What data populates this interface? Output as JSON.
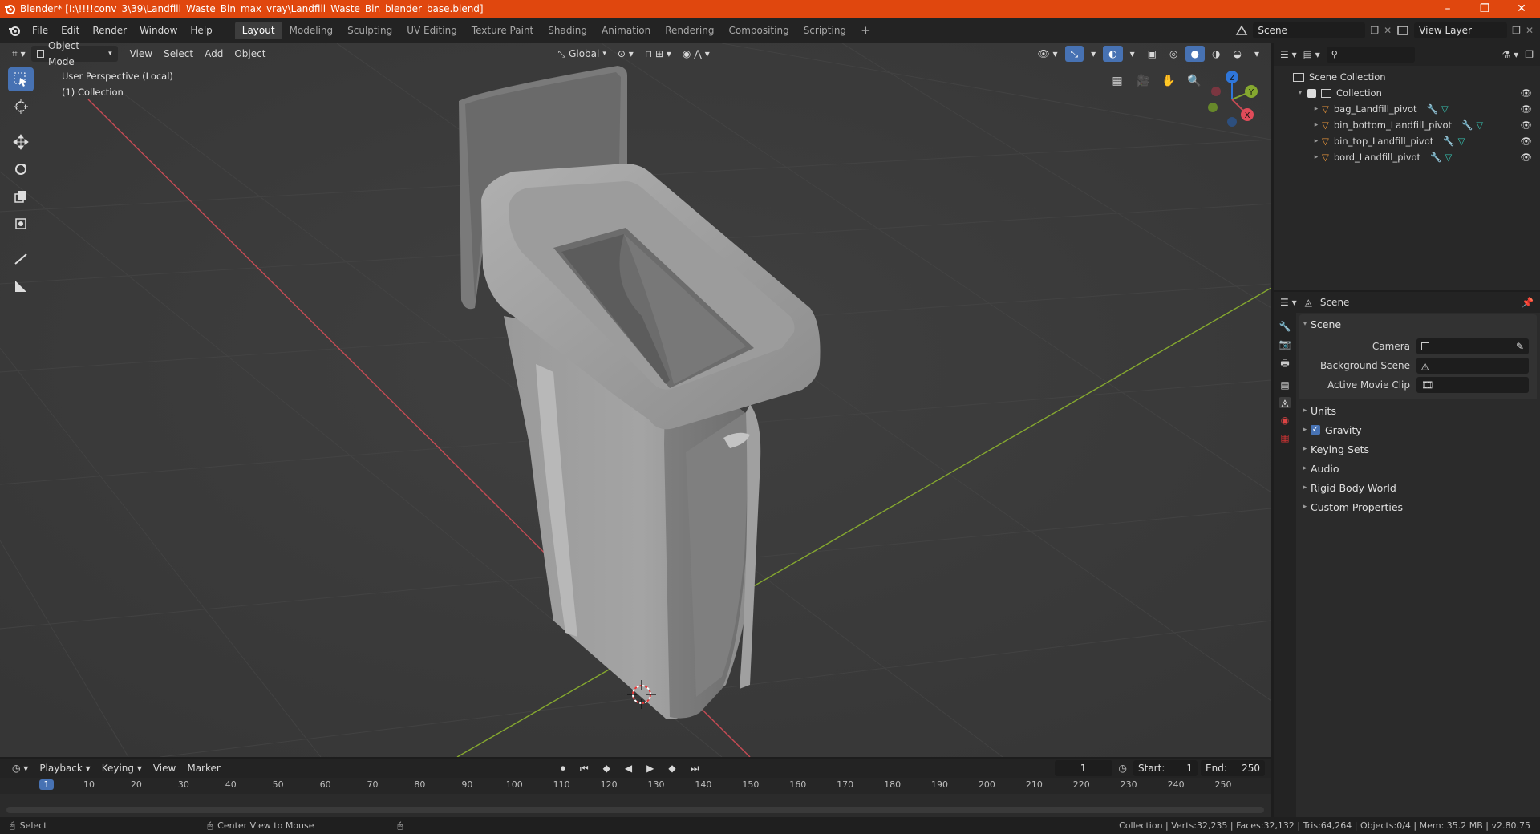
{
  "titlebar": {
    "title": "Blender* [I:\\!!!!conv_3\\39\\Landfill_Waste_Bin_max_vray\\Landfill_Waste_Bin_blender_base.blend]",
    "minimize": "–",
    "restore": "❐",
    "close": "✕"
  },
  "menu": [
    "File",
    "Edit",
    "Render",
    "Window",
    "Help"
  ],
  "workspaces": [
    "Layout",
    "Modeling",
    "Sculpting",
    "UV Editing",
    "Texture Paint",
    "Shading",
    "Animation",
    "Rendering",
    "Compositing",
    "Scripting"
  ],
  "scene_field": "Scene",
  "view_layer_field": "View Layer",
  "viewport": {
    "mode": "Object Mode",
    "menus": [
      "View",
      "Select",
      "Add",
      "Object"
    ],
    "orientation": "Global",
    "overlay_title": "User Perspective (Local)",
    "overlay_collection": "(1) Collection",
    "gizmo_axes": {
      "x": "X",
      "y": "Y",
      "z": "Z"
    }
  },
  "outliner": {
    "root": "Scene Collection",
    "collection": "Collection",
    "objects": [
      "bag_Landfill_pivot",
      "bin_bottom_Landfill_pivot",
      "bin_top_Landfill_pivot",
      "bord_Landfill_pivot"
    ]
  },
  "properties": {
    "header": "Scene",
    "panel_title": "Scene",
    "camera_label": "Camera",
    "background_scene_label": "Background Scene",
    "active_movie_clip_label": "Active Movie Clip",
    "sections": [
      "Units",
      "Gravity",
      "Keying Sets",
      "Audio",
      "Rigid Body World",
      "Custom Properties"
    ]
  },
  "timeline": {
    "menus": [
      "Playback",
      "Keying",
      "View",
      "Marker"
    ],
    "current_frame": "1",
    "start_label": "Start:",
    "start": "1",
    "end_label": "End:",
    "end": "250",
    "ruler": [
      "1",
      "10",
      "20",
      "30",
      "40",
      "50",
      "60",
      "70",
      "80",
      "90",
      "100",
      "110",
      "120",
      "130",
      "140",
      "150",
      "160",
      "170",
      "180",
      "190",
      "200",
      "210",
      "220",
      "230",
      "240",
      "250"
    ]
  },
  "status": {
    "left_action": "Select",
    "middle_action": "Center View to Mouse",
    "stats": "Collection | Verts:32,235 | Faces:32,132 | Tris:64,264 | Objects:0/4 | Mem: 35.2 MB | v2.80.75"
  },
  "colors": {
    "title_bar": "#e0470e",
    "accent": "#4772b3",
    "x_axis": "#c64b54",
    "y_axis": "#85a82f",
    "object_icon": "#e8953a"
  }
}
